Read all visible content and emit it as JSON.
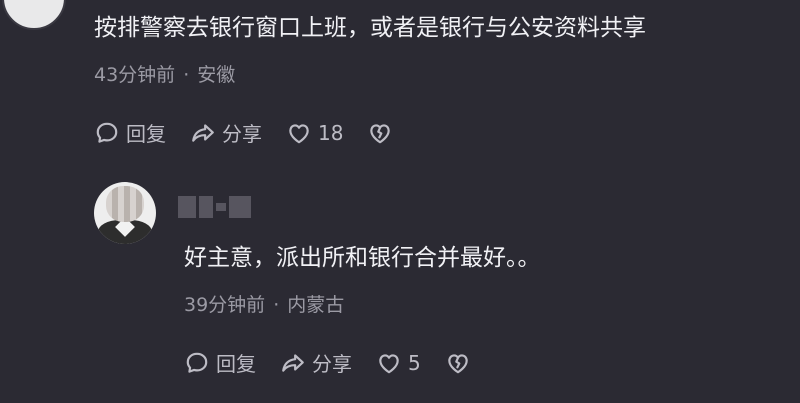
{
  "comment": {
    "text": "按排警察去银行窗口上班，或者是银行与公安资料共享",
    "time": "43分钟前",
    "separator": "·",
    "location": "安徽",
    "reply_label": "回复",
    "share_label": "分享",
    "like_count": "18"
  },
  "reply": {
    "text": "好主意，派出所和银行合并最好。。",
    "time": "39分钟前",
    "separator": "·",
    "location": "内蒙古",
    "reply_label": "回复",
    "share_label": "分享",
    "like_count": "5"
  },
  "icons": {
    "reply": "comment-bubble-icon",
    "share": "share-arrow-icon",
    "like": "heart-icon",
    "dislike": "broken-heart-icon"
  }
}
